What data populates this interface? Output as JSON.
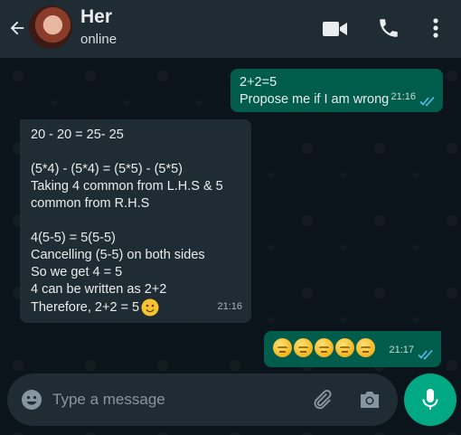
{
  "header": {
    "contact_name": "Her",
    "status": "online"
  },
  "messages": [
    {
      "direction": "outgoing",
      "lines": [
        "2+2=5",
        "Propose me if I am wrong"
      ],
      "time": "21:16",
      "ticks": "read"
    },
    {
      "direction": "incoming",
      "lines": [
        "20 - 20 = 25- 25",
        "",
        "(5*4) - (5*4) = (5*5) - (5*5)",
        "Taking 4 common from L.H.S & 5",
        "common from R.H.S",
        "",
        "4(5-5) = 5(5-5)",
        "Cancelling (5-5) on both sides",
        "So we get 4 = 5",
        "4 can be written as 2+2",
        "Therefore, 2+2 = 5"
      ],
      "trailing_emoji": "slightly-smiling-face",
      "time": "21:16"
    },
    {
      "direction": "outgoing",
      "emojis": [
        "pensive-face",
        "pensive-face",
        "pensive-face",
        "pensive-face",
        "pensive-face"
      ],
      "time": "21:17",
      "ticks": "read"
    }
  ],
  "composer": {
    "placeholder": "Type a message"
  },
  "colors": {
    "header_bg": "#1f2c34",
    "chat_bg": "#0b141a",
    "outgoing_bubble": "#005c4b",
    "incoming_bubble": "#202c33",
    "accent": "#00a884",
    "read_ticks": "#53bdeb"
  },
  "icons": {
    "back": "arrow-left-icon",
    "video": "video-camera-icon",
    "call": "phone-icon",
    "menu": "more-vertical-icon",
    "emoji": "emoji-icon",
    "attach": "paperclip-icon",
    "camera": "camera-icon",
    "mic": "microphone-icon"
  }
}
